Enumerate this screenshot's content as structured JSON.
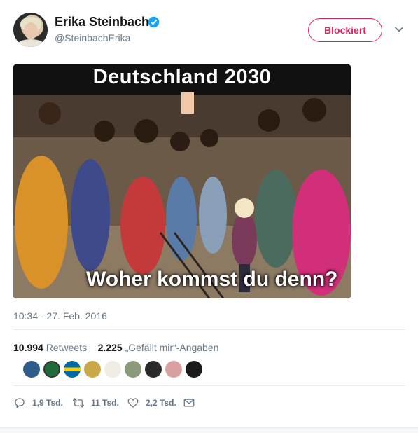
{
  "author": {
    "name": "Erika Steinbach",
    "handle": "@SteinbachErika",
    "verified": true
  },
  "header": {
    "blocked_label": "Blockiert"
  },
  "media": {
    "top_text": "Deutschland 2030",
    "bottom_text": "Woher kommst du denn?"
  },
  "timestamp": "10:34 - 27. Feb. 2016",
  "stats": {
    "retweets_count": "10.994",
    "retweets_label": "Retweets",
    "likes_count": "2.225",
    "likes_label": "„Gefällt mir“-Angaben"
  },
  "actions": {
    "reply_count": "1,9 Tsd.",
    "retweet_count": "11 Tsd.",
    "like_count": "2,2 Tsd."
  },
  "colors": {
    "blocked_red": "#e0245e",
    "verified_blue": "#1da1f2",
    "muted": "#657786"
  }
}
